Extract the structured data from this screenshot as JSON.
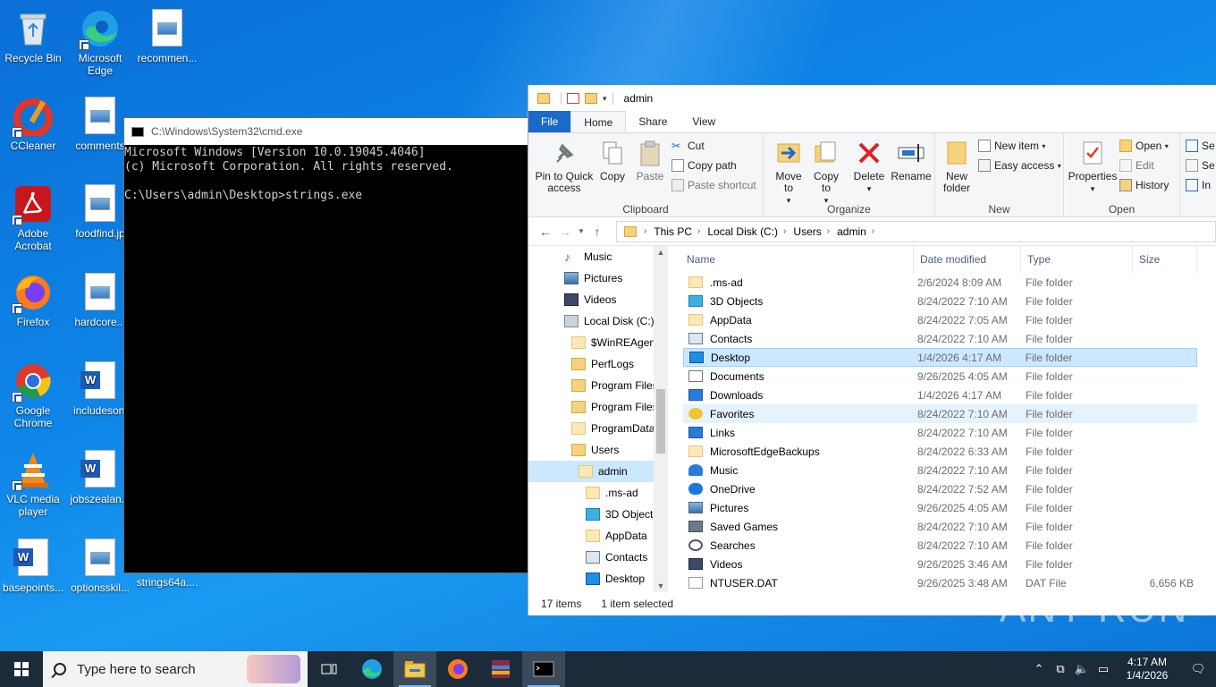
{
  "desktop": {
    "icons": [
      {
        "label": "Recycle Bin"
      },
      {
        "label": "Microsoft Edge"
      },
      {
        "label": "recommen..."
      },
      {
        "label": "CCleaner"
      },
      {
        "label": "comments"
      },
      {
        "label": "Adobe Acrobat"
      },
      {
        "label": "foodfind.jp"
      },
      {
        "label": "Firefox"
      },
      {
        "label": "hardcore..."
      },
      {
        "label": "Google Chrome"
      },
      {
        "label": "includesonl"
      },
      {
        "label": "VLC media player"
      },
      {
        "label": "jobszealan..."
      },
      {
        "label": "basepoints..."
      },
      {
        "label": "optionsskil..."
      },
      {
        "label": "strings64a...."
      }
    ]
  },
  "cmd": {
    "title": "C:\\Windows\\System32\\cmd.exe",
    "lines": "Microsoft Windows [Version 10.0.19045.4046]\n(c) Microsoft Corporation. All rights reserved.\n\nC:\\Users\\admin\\Desktop>strings.exe"
  },
  "explorer": {
    "title": "admin",
    "tabs": [
      "File",
      "Home",
      "Share",
      "View"
    ],
    "ribbon": {
      "clipboard": {
        "name": "Clipboard",
        "pin": "Pin to Quick access",
        "copy": "Copy",
        "paste": "Paste",
        "cut": "Cut",
        "copy_path": "Copy path",
        "paste_shortcut": "Paste shortcut"
      },
      "organize": {
        "name": "Organize",
        "move_to": "Move to",
        "copy_to": "Copy to",
        "delete": "Delete",
        "rename": "Rename"
      },
      "new": {
        "name": "New",
        "new_folder": "New folder",
        "new_item": "New item",
        "easy_access": "Easy access"
      },
      "open": {
        "name": "Open",
        "properties": "Properties",
        "open": "Open",
        "edit": "Edit",
        "history": "History"
      },
      "select": {
        "s1": "Se",
        "s2": "Se",
        "s3": "In"
      }
    },
    "breadcrumb": [
      "This PC",
      "Local Disk (C:)",
      "Users",
      "admin"
    ],
    "nav": [
      {
        "label": "Music",
        "indent": 1
      },
      {
        "label": "Pictures",
        "indent": 1
      },
      {
        "label": "Videos",
        "indent": 1
      },
      {
        "label": "Local Disk (C:)",
        "indent": 1
      },
      {
        "label": "$WinREAgent",
        "indent": 2
      },
      {
        "label": "PerfLogs",
        "indent": 2
      },
      {
        "label": "Program Files",
        "indent": 2
      },
      {
        "label": "Program Files",
        "indent": 2
      },
      {
        "label": "ProgramData",
        "indent": 2
      },
      {
        "label": "Users",
        "indent": 2
      },
      {
        "label": "admin",
        "indent": 3
      },
      {
        "label": ".ms-ad",
        "indent": 4
      },
      {
        "label": "3D Objects",
        "indent": 4
      },
      {
        "label": "AppData",
        "indent": 4
      },
      {
        "label": "Contacts",
        "indent": 4
      },
      {
        "label": "Desktop",
        "indent": 4
      }
    ],
    "columns": {
      "name": "Name",
      "date": "Date modified",
      "type": "Type",
      "size": "Size"
    },
    "rows": [
      {
        "name": ".ms-ad",
        "date": "2/6/2024 8:09 AM",
        "type": "File folder",
        "size": ""
      },
      {
        "name": "3D Objects",
        "date": "8/24/2022 7:10 AM",
        "type": "File folder",
        "size": ""
      },
      {
        "name": "AppData",
        "date": "8/24/2022 7:05 AM",
        "type": "File folder",
        "size": ""
      },
      {
        "name": "Contacts",
        "date": "8/24/2022 7:10 AM",
        "type": "File folder",
        "size": ""
      },
      {
        "name": "Desktop",
        "date": "1/4/2026 4:17 AM",
        "type": "File folder",
        "size": ""
      },
      {
        "name": "Documents",
        "date": "9/26/2025 4:05 AM",
        "type": "File folder",
        "size": ""
      },
      {
        "name": "Downloads",
        "date": "1/4/2026 4:17 AM",
        "type": "File folder",
        "size": ""
      },
      {
        "name": "Favorites",
        "date": "8/24/2022 7:10 AM",
        "type": "File folder",
        "size": ""
      },
      {
        "name": "Links",
        "date": "8/24/2022 7:10 AM",
        "type": "File folder",
        "size": ""
      },
      {
        "name": "MicrosoftEdgeBackups",
        "date": "8/24/2022 6:33 AM",
        "type": "File folder",
        "size": ""
      },
      {
        "name": "Music",
        "date": "8/24/2022 7:10 AM",
        "type": "File folder",
        "size": ""
      },
      {
        "name": "OneDrive",
        "date": "8/24/2022 7:52 AM",
        "type": "File folder",
        "size": ""
      },
      {
        "name": "Pictures",
        "date": "9/26/2025 4:05 AM",
        "type": "File folder",
        "size": ""
      },
      {
        "name": "Saved Games",
        "date": "8/24/2022 7:10 AM",
        "type": "File folder",
        "size": ""
      },
      {
        "name": "Searches",
        "date": "8/24/2022 7:10 AM",
        "type": "File folder",
        "size": ""
      },
      {
        "name": "Videos",
        "date": "9/26/2025 3:46 AM",
        "type": "File folder",
        "size": ""
      },
      {
        "name": "NTUSER.DAT",
        "date": "9/26/2025 3:48 AM",
        "type": "DAT File",
        "size": "6,656 KB"
      }
    ],
    "status": {
      "count": "17 items",
      "selected": "1 item selected"
    }
  },
  "taskbar": {
    "search_placeholder": "Type here to search",
    "time": "4:17 AM",
    "date": "1/4/2026"
  },
  "watermark": "ANY RUN"
}
